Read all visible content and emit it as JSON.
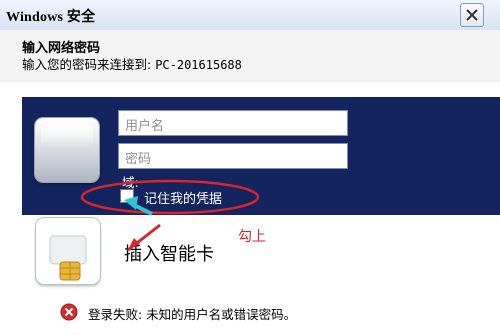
{
  "window": {
    "title": "Windows 安全",
    "close_icon": "close-x-icon"
  },
  "header": {
    "title": "输入网络密码",
    "subtitle_prefix": "输入您的密码来连接到: ",
    "subtitle_host": "PC-201615688"
  },
  "credentials": {
    "username_placeholder": "用户名",
    "password_placeholder": "密码",
    "domain_label": "域:",
    "remember_label": "记住我的凭据",
    "user_tile_icon": "user-tile-icon"
  },
  "smartcard": {
    "label": "插入智能卡",
    "icon": "smart-card-icon"
  },
  "annotation": {
    "text": "勾上",
    "color": "#d8262c"
  },
  "error": {
    "icon": "error-icon",
    "message": "登录失败: 未知的用户名或错误密码。"
  },
  "colors": {
    "panel": "#13245f",
    "accent_arrow": "#2ec3d6"
  }
}
